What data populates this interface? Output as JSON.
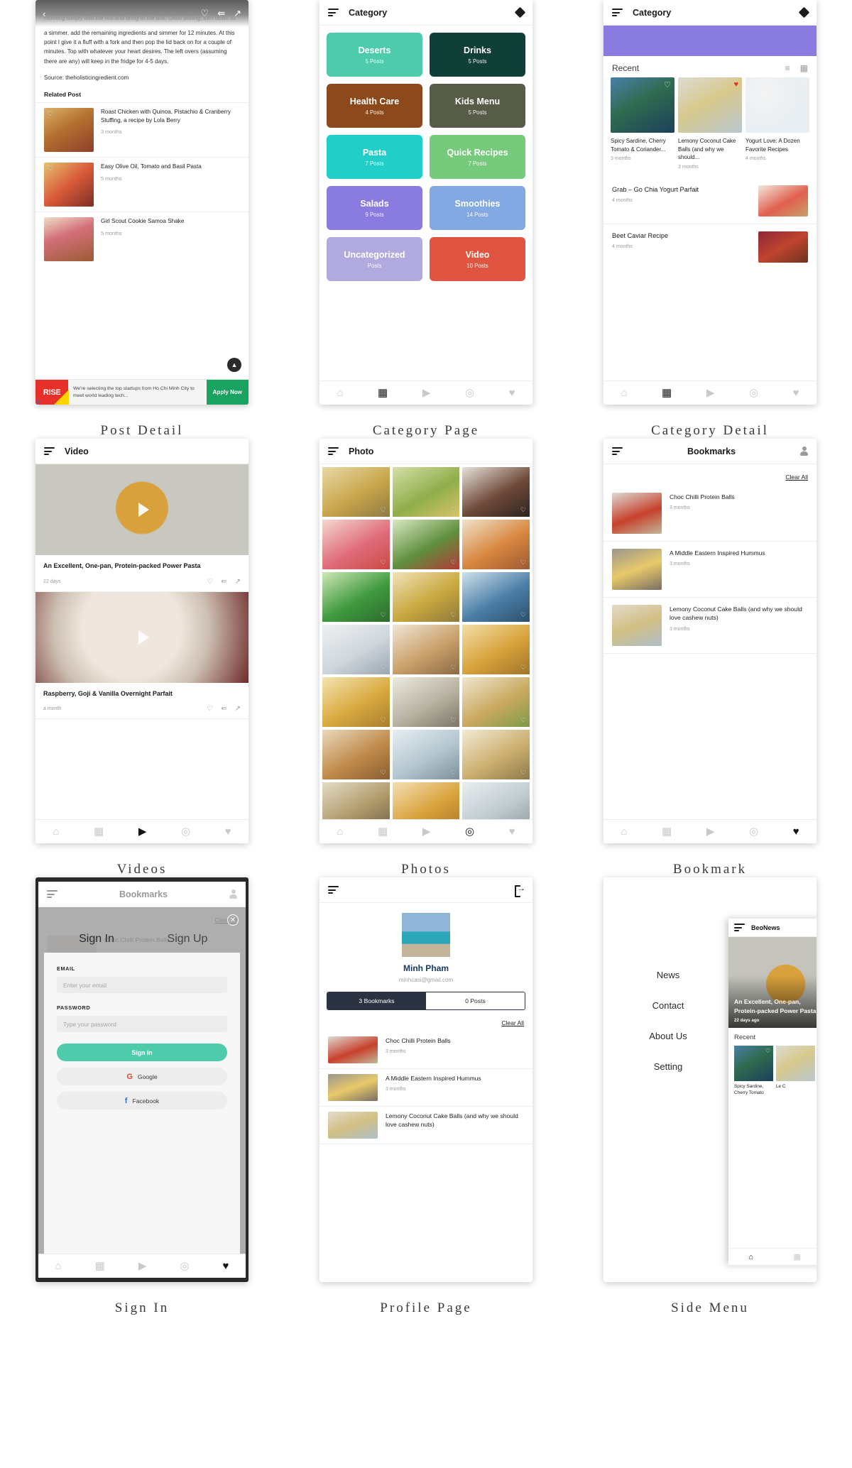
{
  "panels": [
    {
      "caption": "Post Detail"
    },
    {
      "caption": "Category Page"
    },
    {
      "caption": "Category Detail"
    },
    {
      "caption": "Videos"
    },
    {
      "caption": "Photos"
    },
    {
      "caption": "Bookmark"
    },
    {
      "caption": "Sign In"
    },
    {
      "caption": "Profile Page"
    },
    {
      "caption": "Side Menu"
    }
  ],
  "post_detail": {
    "overlay_icons": [
      "back-arrow",
      "heart",
      "share",
      "external-link"
    ],
    "body_text": "a simmer, add the remaining ingredients and simmer for 12 minutes. At this point I give it a fluff with a fork and then pop the lid back on for a couple of minutes. Top with whatever your heart desires. The left overs (assuming there are any) will keep in the fridge for 4-5 days.",
    "faded_text": "then left the saucepan on the stove (heat off) over night, to cool. In the morning simply add the tea and bring to the boil. Once boiling, turn down to",
    "source": "Source: theholisticingredient.com",
    "related_heading": "Related Post",
    "related": [
      {
        "title": "Roast Chicken with Quinoa, Pistachio & Cranberry Stuffing, a recipe by Lola Berry",
        "meta": "3 months"
      },
      {
        "title": "Easy Olive Oil, Tomato and Basil Pasta",
        "meta": "5 months"
      },
      {
        "title": "Girl Scout Cookie Samoa Shake",
        "meta": "5 months"
      }
    ],
    "scroll_top_icon": "chevron-up",
    "ad": {
      "logo": "R!SE",
      "text": "We're selecting the top startups from Ho Chi Minh City to meet world leading tech...",
      "cta": "Apply Now"
    }
  },
  "category_page": {
    "title": "Category",
    "tiles": [
      {
        "name": "Deserts",
        "posts": "5 Posts",
        "color": "#4ecbab"
      },
      {
        "name": "Drinks",
        "posts": "5 Posts",
        "color": "#103f38"
      },
      {
        "name": "Health Care",
        "posts": "4 Posts",
        "color": "#8c4a1c"
      },
      {
        "name": "Kids Menu",
        "posts": "5 Posts",
        "color": "#565c47"
      },
      {
        "name": "Pasta",
        "posts": "7 Posts",
        "color": "#22cfc8"
      },
      {
        "name": "Quick Recipes",
        "posts": "7 Posts",
        "color": "#76ca7c"
      },
      {
        "name": "Salads",
        "posts": "9 Posts",
        "color": "#8a7be0"
      },
      {
        "name": "Smoothies",
        "posts": "14 Posts",
        "color": "#83a9e3"
      },
      {
        "name": "Uncategorized",
        "posts": "Posts",
        "color": "#b0aade"
      },
      {
        "name": "Video",
        "posts": "10 Posts",
        "color": "#df5542"
      }
    ]
  },
  "category_detail": {
    "title": "Category",
    "hero_color": "#8a7be0",
    "section": "Recent",
    "icons": [
      "filter-icon",
      "grid-icon"
    ],
    "cards": [
      {
        "title": "Spicy Sardine, Cherry Tomato & Coriander...",
        "meta": "3 months",
        "liked": false
      },
      {
        "title": "Lemony Coconut Cake Balls (and why we should...",
        "meta": "3 months",
        "liked": true
      },
      {
        "title": "Yogurt Love: A Dozen Favorite Recipes",
        "meta": "4 months",
        "liked": false
      }
    ],
    "list": [
      {
        "title": "Grab – Go Chia Yogurt Parfait",
        "meta": "4 months"
      },
      {
        "title": "Beet Caviar Recipe",
        "meta": "4 months"
      }
    ]
  },
  "videos": {
    "title": "Video",
    "items": [
      {
        "title": "An Excellent, One-pan, Protein-packed Power Pasta",
        "meta": "22 days"
      },
      {
        "title": "Raspberry, Goji & Vanilla Overnight Parfait",
        "meta": "a month"
      }
    ],
    "actions": [
      "heart-icon",
      "share-icon",
      "external-link-icon"
    ]
  },
  "photos": {
    "title": "Photo",
    "cell_count": 21
  },
  "bookmark": {
    "title": "Bookmarks",
    "clear_all": "Clear All",
    "items": [
      {
        "title": "Choc Chilli Protein Balls",
        "meta": "3 months"
      },
      {
        "title": "A Middle Eastern Inspired Hummus",
        "meta": "3 months"
      },
      {
        "title": "Lemony Coconut Cake Balls (and why we should love cashew nuts)",
        "meta": "3 months"
      }
    ]
  },
  "sign_in": {
    "behind_title": "Bookmarks",
    "behind_clear": "Clear All",
    "behind_item": "Choc Chilli Protein Balls",
    "tab_signin": "Sign In",
    "tab_signup": "Sign Up",
    "email_label": "EMAIL",
    "email_placeholder": "Enter your email",
    "password_label": "PASSWORD",
    "password_placeholder": "Type your password",
    "submit": "Sign In",
    "google": "Google",
    "facebook": "Facebook",
    "accent": "#4ecbab"
  },
  "profile": {
    "name": "Minh Pham",
    "email": "minhcasi@gmail.com",
    "tab_bookmarks": "3 Bookmarks",
    "tab_posts": "0 Posts",
    "clear_all": "Clear All",
    "items": [
      {
        "title": "Choc Chilli Protein Balls",
        "meta": "3 months"
      },
      {
        "title": "A Middle Eastern Inspired Hummus",
        "meta": "3 months"
      },
      {
        "title": "Lemony Coconut Cake Balls (and why we should love cashew nuts)",
        "meta": ""
      }
    ]
  },
  "side_menu": {
    "items": [
      "News",
      "Contact",
      "About Us",
      "Setting"
    ],
    "peek": {
      "brand": "BeoNews",
      "hero_title": "An Excellent, One-pan, Protein-packed Power Pasta",
      "hero_meta": "22 days ago",
      "section": "Recent",
      "cards": [
        {
          "title": "Spicy Sardine, Cherry Tomato"
        },
        {
          "title": "Le C"
        }
      ]
    }
  },
  "bottom_nav": {
    "icons": [
      "home-icon",
      "grid-icon",
      "video-icon",
      "camera-icon",
      "heart-icon"
    ],
    "glyphs": [
      "⌂",
      "▦",
      "▶",
      "◎",
      "♥"
    ]
  }
}
